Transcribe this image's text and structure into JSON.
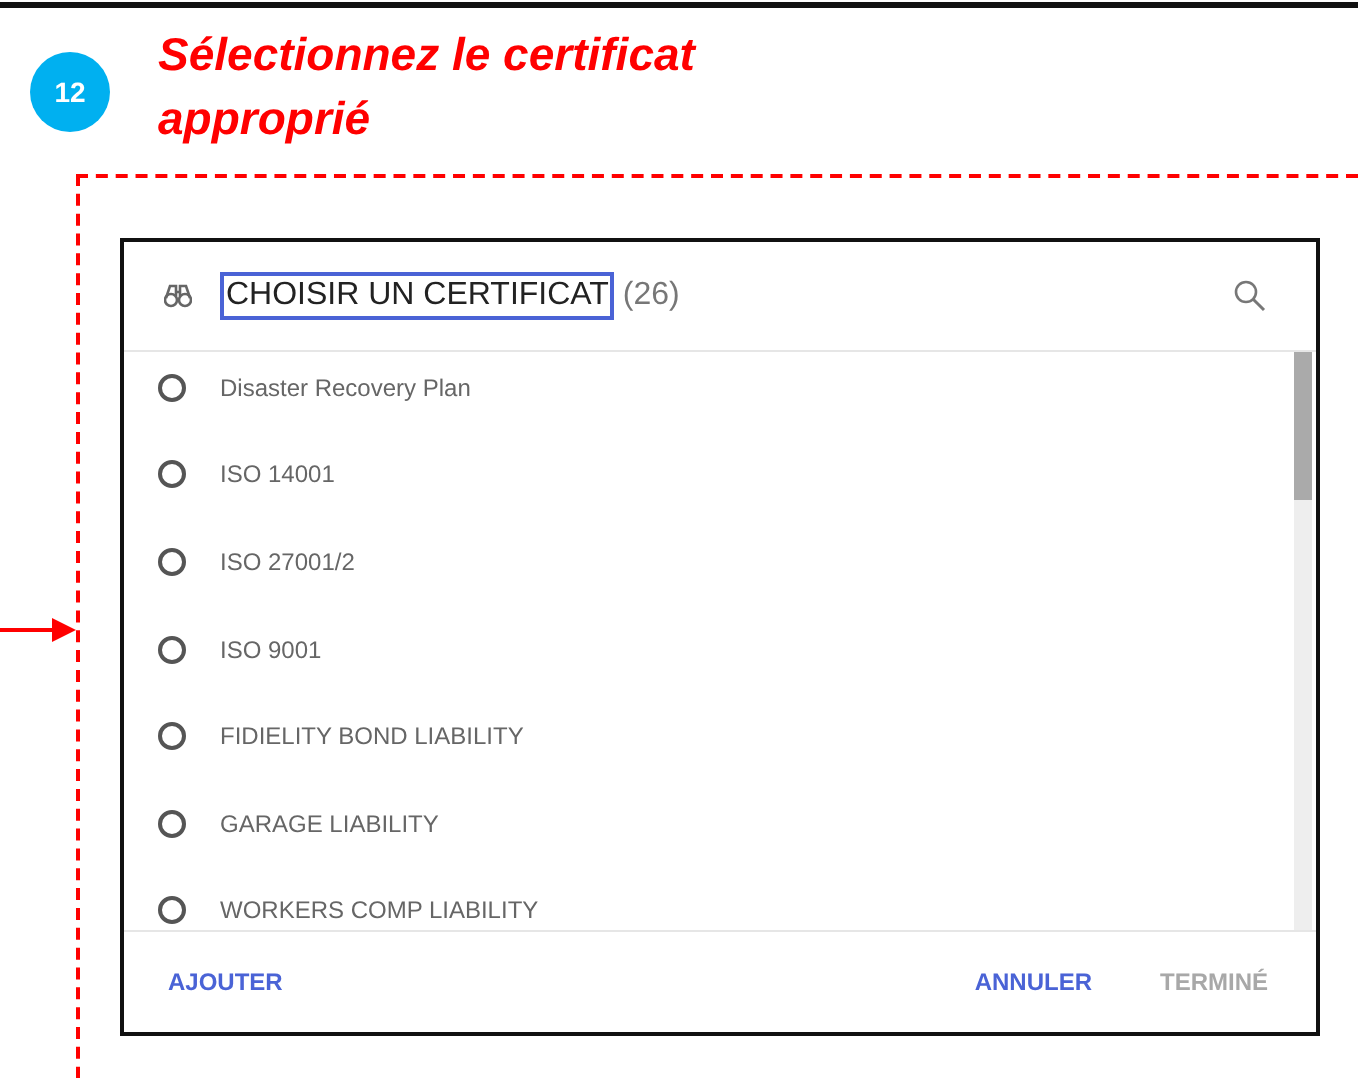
{
  "step": {
    "number": "12",
    "title": "Sélectionnez le certificat approprié"
  },
  "dialog": {
    "title": "CHOISIR UN CERTIFICAT",
    "count": "(26)",
    "items": [
      {
        "label": "Disaster Recovery Plan",
        "selected": false
      },
      {
        "label": "ISO 14001",
        "selected": false
      },
      {
        "label": "ISO 27001/2",
        "selected": false
      },
      {
        "label": "ISO 9001",
        "selected": false
      },
      {
        "label": "FIDIELITY BOND LIABILITY",
        "selected": false
      },
      {
        "label": "GARAGE LIABILITY",
        "selected": false
      },
      {
        "label": "WORKERS COMP LIABILITY",
        "selected": false
      }
    ],
    "buttons": [
      {
        "label": "AJOUTER",
        "disabled": false
      },
      {
        "label": "ANNULER",
        "disabled": false
      },
      {
        "label": "TERMINÉ",
        "disabled": true
      }
    ]
  }
}
